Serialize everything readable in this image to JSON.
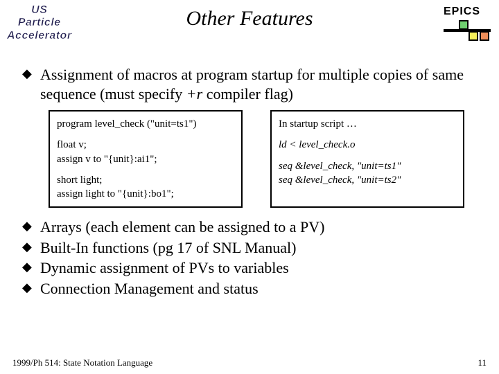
{
  "header": {
    "logo_line1": "US",
    "logo_line2": "Particle",
    "logo_line3": "Accelerator",
    "title": "Other Features",
    "epics_label": "EPICS"
  },
  "bullets": {
    "main": "Assignment of macros at program startup for multiple copies of same sequence (must specify ",
    "main_flag": "+r",
    "main_tail": " compiler flag)"
  },
  "code_left": {
    "l1": "program level_check (\"unit=ts1\")",
    "l2": "float v;",
    "l3": "assign v to \"{unit}:ai1\";",
    "l4": "short light;",
    "l5": "assign light to \"{unit}:bo1\";"
  },
  "code_right": {
    "r1": "In startup script …",
    "r2": "ld < level_check.o",
    "r3": "seq &level_check, \"unit=ts1\"",
    "r4": "seq &level_check, \"unit=ts2\""
  },
  "lower": {
    "b1": "Arrays (each element can be assigned to a PV)",
    "b2": "Built-In functions (pg 17 of SNL Manual)",
    "b3": "Dynamic assignment of PVs to variables",
    "b4": "Connection Management and status"
  },
  "footer": {
    "left": "1999/Ph 514: State Notation Language",
    "right": "11"
  }
}
